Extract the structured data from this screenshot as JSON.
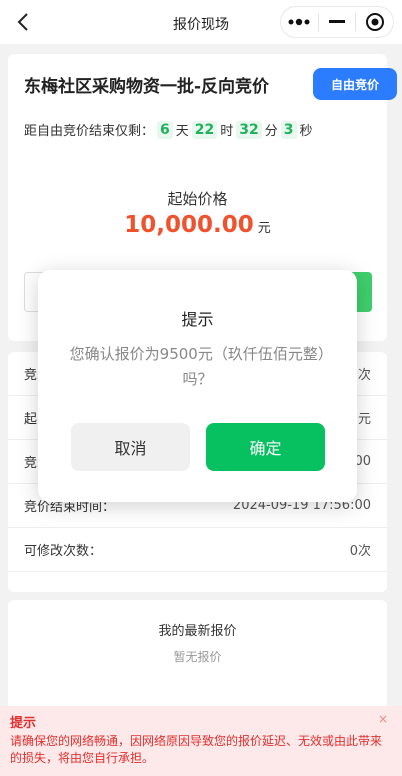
{
  "navbar": {
    "title": "报价现场"
  },
  "auction": {
    "title": "东梅社区采购物资一批-反向竞价",
    "mode_label": "自由竞价",
    "countdown_prefix": "距自由竞价结束仅剩：",
    "days": "6",
    "days_unit": "天",
    "hours": "22",
    "hours_unit": "时",
    "minutes": "32",
    "minutes_unit": "分",
    "seconds": "3",
    "seconds_unit": "秒",
    "start_price_label": "起始价格",
    "start_price": "10,000.00",
    "start_price_unit": "元"
  },
  "info_rows": [
    {
      "label": "竞",
      "value": "次"
    },
    {
      "label": "起",
      "value": "元"
    },
    {
      "label": "竞",
      "value": "00"
    },
    {
      "label": "竞价结束时间：",
      "value": "2024-09-19 17:56:00"
    },
    {
      "label": "可修改次数：",
      "value": "0次"
    }
  ],
  "my_bid": {
    "title": "我的最新报价",
    "empty": "暂无报价"
  },
  "notice": {
    "title": "提示",
    "text": "请确保您的网络畅通，因网络原因导致您的报价延迟、无效或由此带来的损失，将由您自行承担。",
    "close": "×"
  },
  "dialog": {
    "title": "提示",
    "message": "您确认报价为9500元（玖仟伍佰元整）吗？",
    "cancel": "取消",
    "confirm": "确定"
  }
}
